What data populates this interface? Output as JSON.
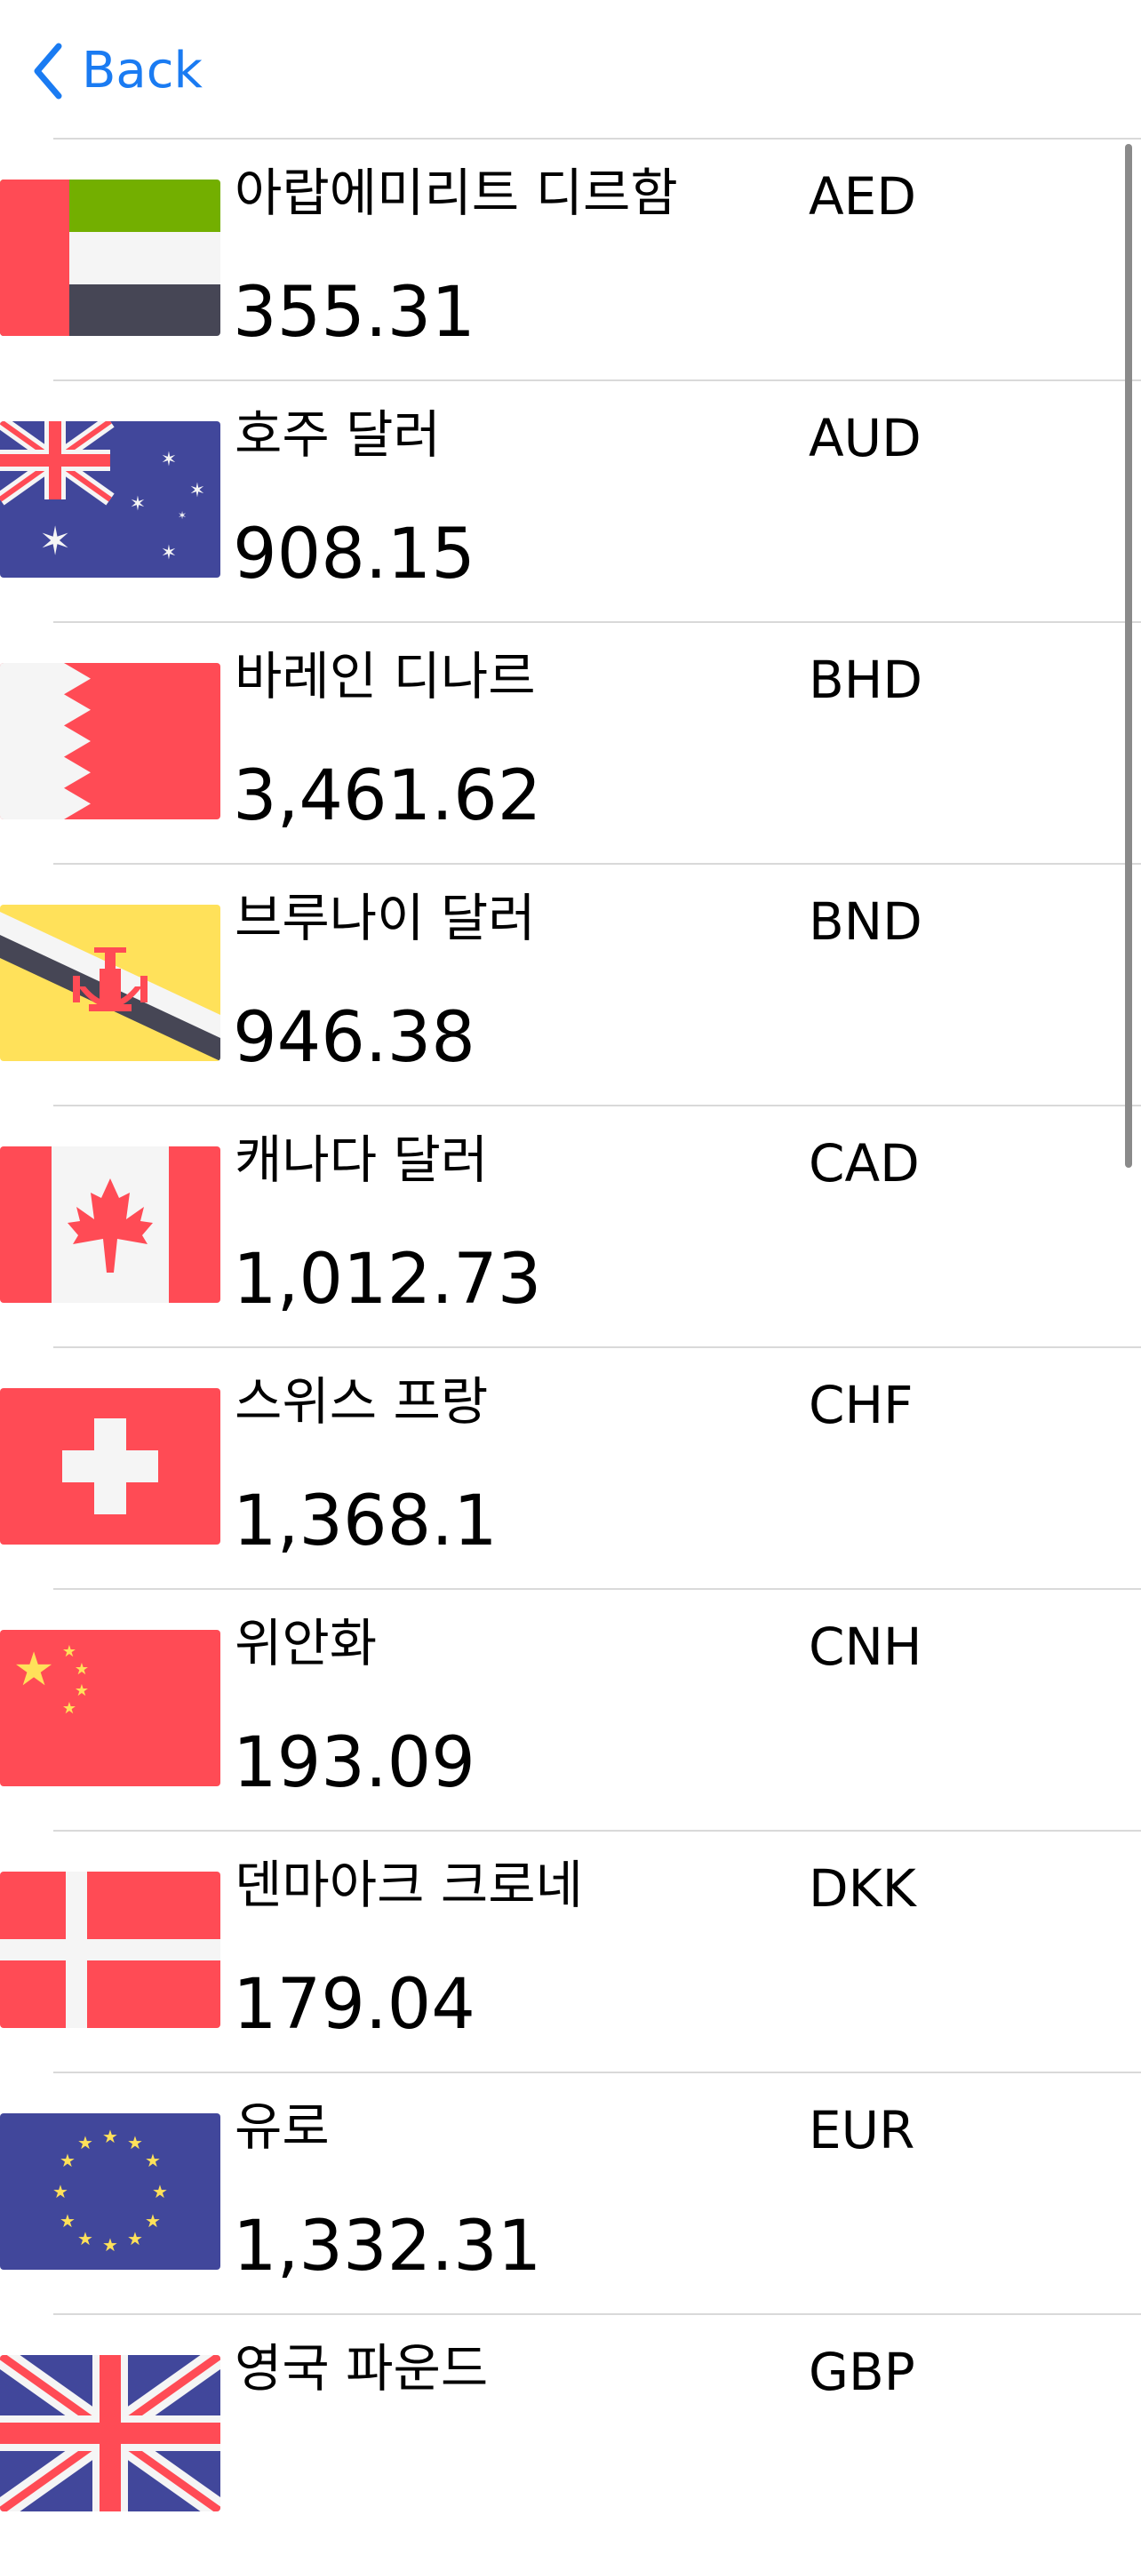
{
  "nav": {
    "back_label": "Back"
  },
  "colors": {
    "accent": "#1a7bf2",
    "flag_red": "#ff4b55",
    "flag_blue": "#41479b",
    "flag_white": "#f5f5f5"
  },
  "currencies": [
    {
      "name": "아랍에미리트 디르함",
      "code": "AED",
      "rate": "355.31",
      "flag": "uae-flag-icon"
    },
    {
      "name": "호주 달러",
      "code": "AUD",
      "rate": "908.15",
      "flag": "australia-flag-icon"
    },
    {
      "name": "바레인 디나르",
      "code": "BHD",
      "rate": "3,461.62",
      "flag": "bahrain-flag-icon"
    },
    {
      "name": "브루나이 달러",
      "code": "BND",
      "rate": "946.38",
      "flag": "brunei-flag-icon"
    },
    {
      "name": "캐나다 달러",
      "code": "CAD",
      "rate": "1,012.73",
      "flag": "canada-flag-icon"
    },
    {
      "name": "스위스 프랑",
      "code": "CHF",
      "rate": "1,368.1",
      "flag": "switzerland-flag-icon"
    },
    {
      "name": "위안화",
      "code": "CNH",
      "rate": "193.09",
      "flag": "china-flag-icon"
    },
    {
      "name": "덴마아크 크로네",
      "code": "DKK",
      "rate": "179.04",
      "flag": "denmark-flag-icon"
    },
    {
      "name": "유로",
      "code": "EUR",
      "rate": "1,332.31",
      "flag": "eu-flag-icon"
    },
    {
      "name": "영국 파운드",
      "code": "GBP",
      "rate": "",
      "flag": "uk-flag-icon"
    }
  ]
}
